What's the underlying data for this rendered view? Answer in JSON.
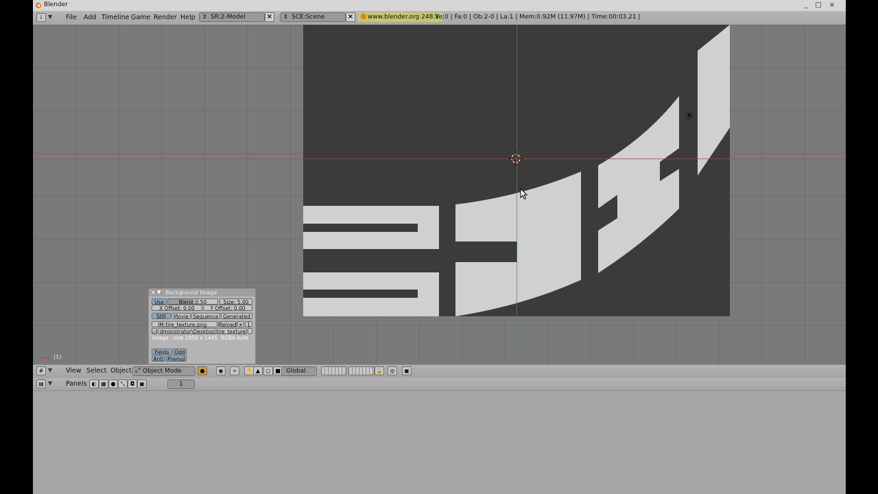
{
  "window": {
    "title": "Blender",
    "controls": [
      "_",
      "□",
      "×"
    ]
  },
  "menubar": {
    "menus": [
      "File",
      "Add",
      "Timeline",
      "Game",
      "Render",
      "Help"
    ],
    "screen": {
      "value": "SR:2-Model",
      "close": "×"
    },
    "scene": {
      "value": "SCE:Scene",
      "close": "×"
    },
    "website": "www.blender.org 248.1",
    "stats": "Ve:0 | Fa:0 | Ob:2-0 | La:1  | Mem:0.92M (11.97M)  | Time:00:03.21 |"
  },
  "viewport": {
    "frame_number": "(1)",
    "accent": {
      "x_axis": "#a04e4e",
      "y_axis": "#4e8a4e"
    }
  },
  "bg_panel": {
    "title": "Background Image",
    "use": "Use",
    "blend": "Blend:0.50",
    "size": "Size: 5.00",
    "x_offset": "X Offset: 0.00",
    "y_offset": "Y Offset: 0.00",
    "tabs": [
      "Still",
      "Movie",
      "Sequence",
      "Generated"
    ],
    "image_name": "IM:tire_texture.png",
    "reload": "Reload",
    "users": "1",
    "path": "dministrator\\Desktop\\tire_texture.png",
    "info": "Image : size 1956 x 1445, RGBA byte",
    "fields": "Fields",
    "odd": "Odd",
    "anti": "Anti",
    "premul": "Premul"
  },
  "view_header": {
    "menus": [
      "View",
      "Select",
      "Object"
    ],
    "mode": "Object Mode",
    "orientation": "Global"
  },
  "buttons_header": {
    "panels": "Panels",
    "frame": "1"
  }
}
